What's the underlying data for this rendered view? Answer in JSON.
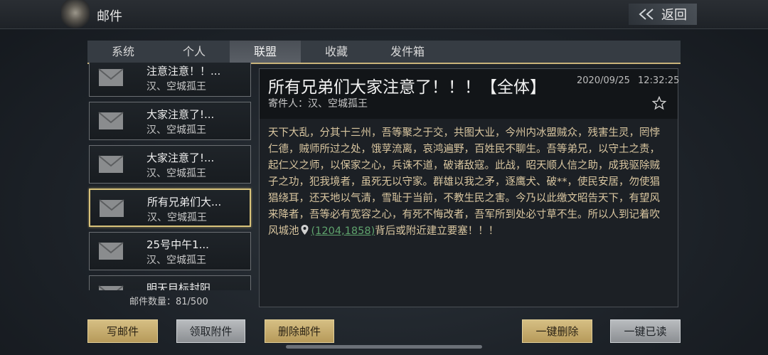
{
  "header": {
    "title": "邮件",
    "back_label": "返回"
  },
  "tabs": [
    {
      "label": "系统",
      "active": false
    },
    {
      "label": "个人",
      "active": false
    },
    {
      "label": "联盟",
      "active": true
    },
    {
      "label": "收藏",
      "active": false
    },
    {
      "label": "发件箱",
      "active": false
    }
  ],
  "mails": [
    {
      "subject": "注意注意！！...",
      "sender": "汉、空城孤王",
      "selected": false
    },
    {
      "subject": "大家注意了!...",
      "sender": "汉、空城孤王",
      "selected": false
    },
    {
      "subject": "大家注意了!...",
      "sender": "汉、空城孤王",
      "selected": false
    },
    {
      "subject": "所有兄弟们大...",
      "sender": "汉、空城孤王",
      "selected": true
    },
    {
      "subject": "25号中午1...",
      "sender": "汉、空城孤王",
      "selected": false
    },
    {
      "subject": "明天目标封阳",
      "sender": "",
      "selected": false
    }
  ],
  "mail_count": "邮件数量：81/500",
  "detail": {
    "title": "所有兄弟们大家注意了！！！【全体】",
    "date": "2020/09/25",
    "time": "12:32:25",
    "from": "寄件人：汉、空城孤王",
    "body_before": "天下大乱，分其十三州，吾等聚之于交，共图大业，今州内冰盟贼众，残害生灵，罔悖仁德，贼师所过之处，饿莩流离，哀鸿遍野，百姓民不聊生。吾等弟兄，以守土之责，起仁义之师，以保家之心，兵诛不道，破诸敌寇。此战，昭天顺人信之助，成我驱除贼子之功，犯我境者，虽死无以守家。群雄以我之矛，逐鹰犬、破**，使民安居，勿使猖猖绕耳，还天地以气清，雪耻于当前，不教生民之害。今乃以此缴文昭告天下，有望风来降者，吾等必有宽容之心，有死不悔改者，吾军所到处必寸草不生。所以人到记着吹风城池",
    "coord": "(1204,1858)",
    "body_after": "背后或附近建立要塞！！！"
  },
  "buttons": {
    "write": "写邮件",
    "collect": "领取附件",
    "delete": "删除邮件",
    "delete_all": "一键删除",
    "read_all": "一键已读"
  },
  "colors": {
    "gold_accent": "#d8c27a",
    "body_text": "#d9c6a0",
    "coord_link": "#5fa36d"
  },
  "icons": [
    "back-arrow-icon",
    "envelope-icon",
    "star-icon",
    "location-pin-icon"
  ]
}
